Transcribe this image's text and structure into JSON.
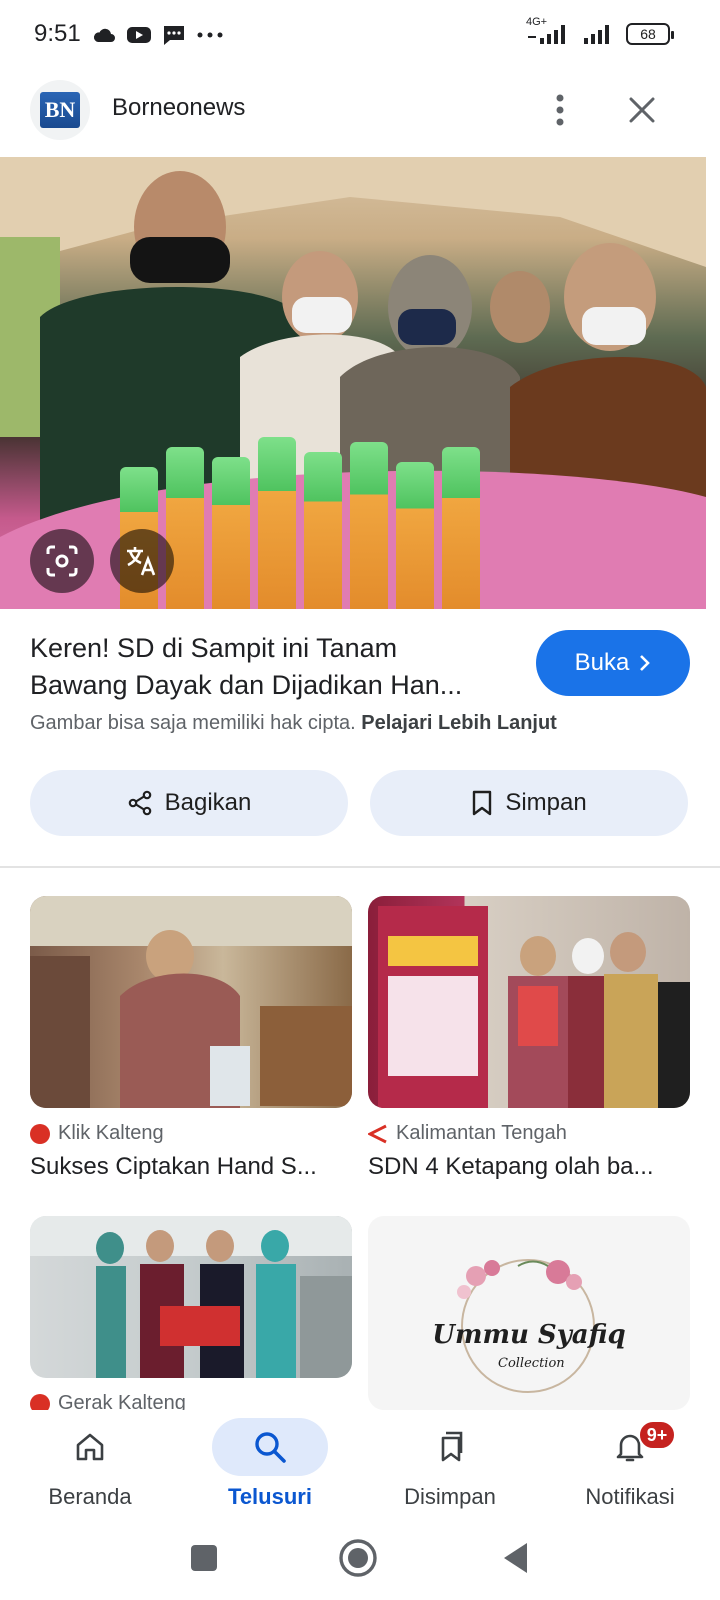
{
  "status_bar": {
    "time": "9:51",
    "network_label": "4G+",
    "battery": "68"
  },
  "header": {
    "site_logo_text": "BN",
    "site_name": "Borneonews"
  },
  "article": {
    "title_line1": "Keren! SD di Sampit ini Tanam",
    "title_line2": "Bawang Dayak dan Dijadikan Han...",
    "open_label": "Buka",
    "copyright_text": "Gambar bisa saja memiliki hak cipta.",
    "learn_more": "Pelajari Lebih Lanjut"
  },
  "actions": {
    "share_label": "Bagikan",
    "save_label": "Simpan"
  },
  "related": [
    {
      "source": "Klik Kalteng",
      "title": "Sukses Ciptakan Hand S...",
      "source_color": "#d93025"
    },
    {
      "source": "Kalimantan Tengah",
      "title": "SDN 4 Ketapang olah ba...",
      "source_color": "#d93025"
    },
    {
      "source": "Gerak Kalteng",
      "title": "",
      "source_color": "#d93025"
    },
    {
      "source": "",
      "title": "",
      "logo_text_1": "Ummu Syafiq",
      "logo_text_2": "Collection"
    }
  ],
  "bottom_nav": {
    "items": [
      {
        "label": "Beranda",
        "icon": "home-icon"
      },
      {
        "label": "Telusuri",
        "icon": "search-icon",
        "active": true
      },
      {
        "label": "Disimpan",
        "icon": "bookmarks-icon"
      },
      {
        "label": "Notifikasi",
        "icon": "bell-icon",
        "badge": "9+"
      }
    ]
  },
  "colors": {
    "accent": "#1a73e8",
    "active_nav": "#0b57d0",
    "badge": "#c5221f",
    "action_bg": "#e8eef9"
  }
}
